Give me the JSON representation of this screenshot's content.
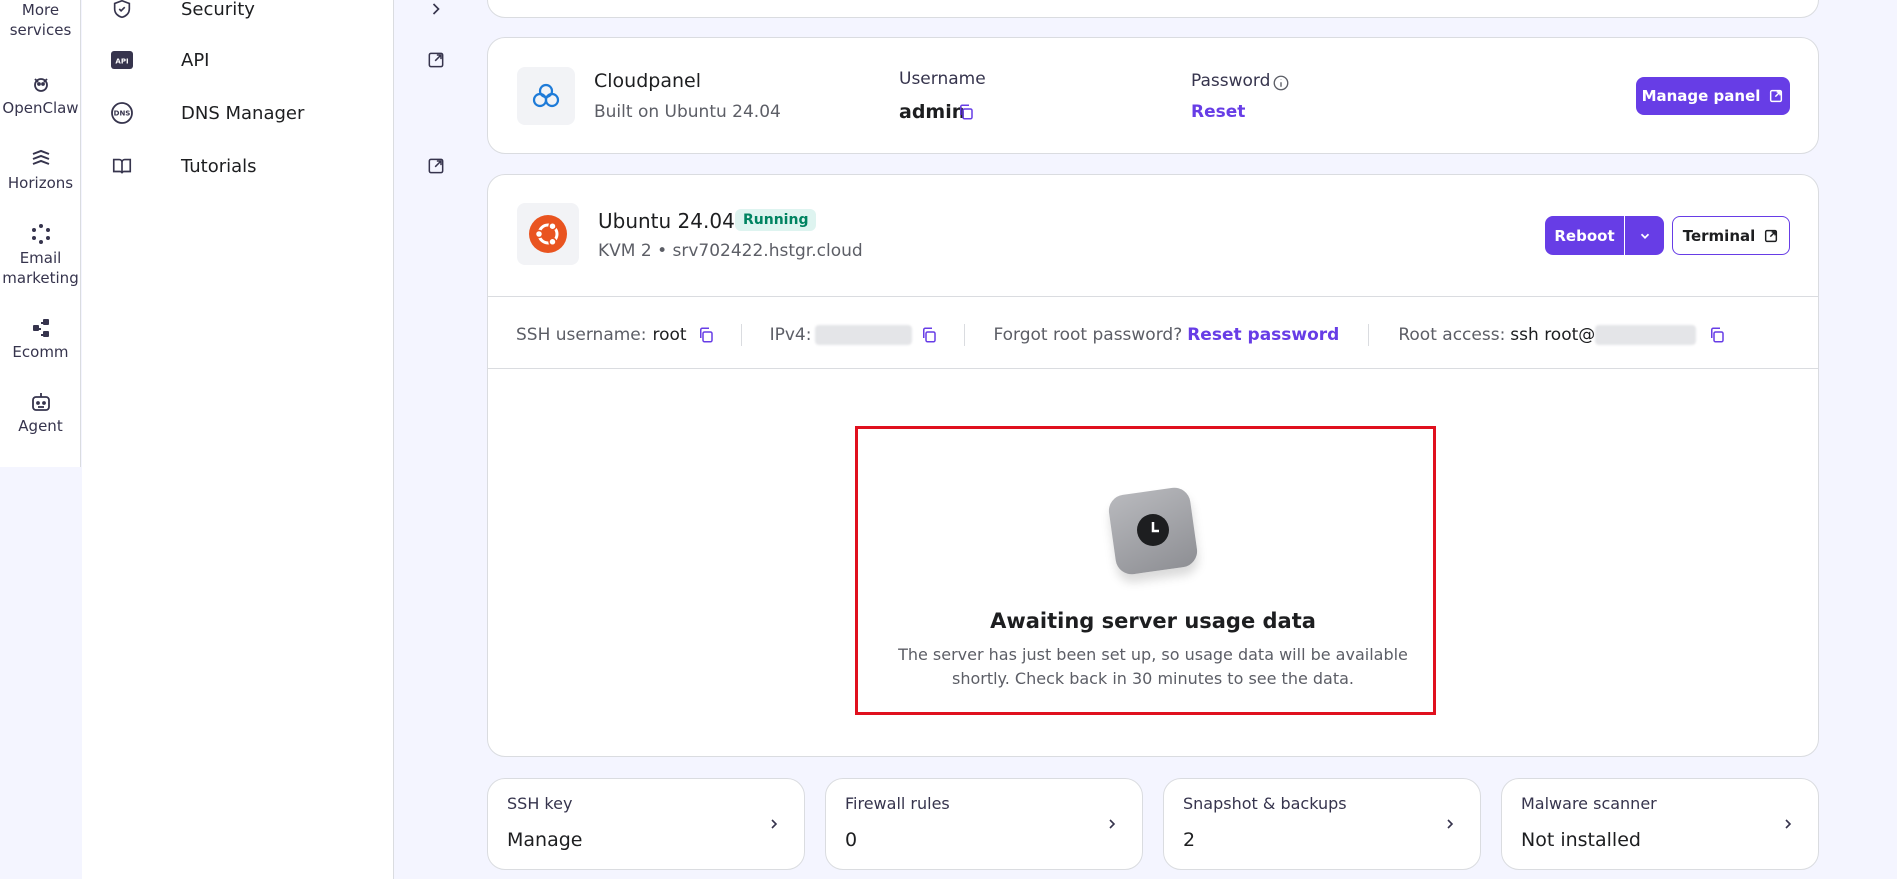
{
  "rail": {
    "items": [
      {
        "label_line1": "More",
        "label_line2": "services",
        "icon": "more-services-icon"
      },
      {
        "label_line1": "OpenClaw",
        "label_line2": "",
        "icon": "openclaw-icon"
      },
      {
        "label_line1": "Horizons",
        "label_line2": "",
        "icon": "horizons-icon"
      },
      {
        "label_line1": "Email",
        "label_line2": "marketing",
        "icon": "email-marketing-icon"
      },
      {
        "label_line1": "Ecomm",
        "label_line2": "",
        "icon": "ecomm-icon"
      },
      {
        "label_line1": "Agent",
        "label_line2": "",
        "icon": "agent-icon"
      }
    ]
  },
  "sidebar": {
    "items": [
      {
        "label": "Security",
        "icon": "shield-icon",
        "trail": "chevron-right-icon"
      },
      {
        "label": "API",
        "icon": "api-icon",
        "trail": "external-link-icon"
      },
      {
        "label": "DNS Manager",
        "icon": "dns-icon",
        "trail": ""
      },
      {
        "label": "Tutorials",
        "icon": "book-icon",
        "trail": "external-link-icon"
      }
    ]
  },
  "cloudpanel": {
    "name": "Cloudpanel",
    "subtitle": "Built on Ubuntu 24.04",
    "username_label": "Username",
    "username_value": "admin",
    "password_label": "Password",
    "password_action": "Reset",
    "manage_button": "Manage panel"
  },
  "server": {
    "os": "Ubuntu 24.04",
    "status": "Running",
    "plan_host": "KVM 2 • srv702422.hstgr.cloud",
    "reboot_button": "Reboot",
    "terminal_button": "Terminal",
    "ssh_username_label": "SSH username:",
    "ssh_username_value": "root",
    "ipv4_label": "IPv4:",
    "forgot_label": "Forgot root password?",
    "reset_password": "Reset password",
    "root_access_label": "Root access:",
    "root_access_value": "ssh root@"
  },
  "usage": {
    "title": "Awaiting server usage data",
    "line1": "The server has just been set up, so usage data will be available",
    "line2": "shortly. Check back in 30 minutes to see the data."
  },
  "tiles": [
    {
      "caption": "SSH key",
      "value": "Manage"
    },
    {
      "caption": "Firewall rules",
      "value": "0"
    },
    {
      "caption": "Snapshot & backups",
      "value": "2"
    },
    {
      "caption": "Malware scanner",
      "value": "Not installed"
    }
  ],
  "colors": {
    "accent": "#673de6",
    "running_bg": "#def4f0",
    "running_text": "#008361",
    "highlight": "#e0101e",
    "ubuntu": "#e95420",
    "cloud": "#1e7bd8"
  }
}
